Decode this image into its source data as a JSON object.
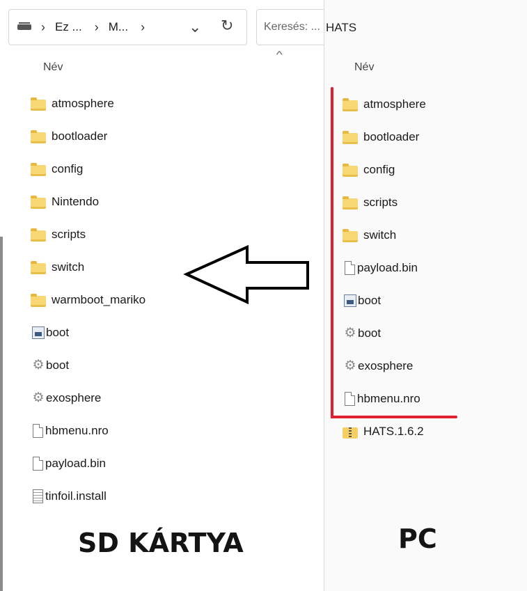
{
  "left_pane": {
    "breadcrumb": [
      "Ez ...",
      "M..."
    ],
    "column_header": "Név",
    "items": [
      {
        "icon": "folder-icon",
        "name": "atmosphere"
      },
      {
        "icon": "folder-icon",
        "name": "bootloader"
      },
      {
        "icon": "folder-icon",
        "name": "config"
      },
      {
        "icon": "folder-icon",
        "name": "Nintendo"
      },
      {
        "icon": "folder-icon",
        "name": "scripts"
      },
      {
        "icon": "folder-icon",
        "name": "switch"
      },
      {
        "icon": "folder-icon",
        "name": "warmboot_mariko"
      },
      {
        "icon": "batch-file-icon",
        "name": "boot"
      },
      {
        "icon": "settings-file-icon",
        "name": "boot"
      },
      {
        "icon": "settings-file-icon",
        "name": "exosphere"
      },
      {
        "icon": "file-icon",
        "name": "hbmenu.nro"
      },
      {
        "icon": "file-icon",
        "name": "payload.bin"
      },
      {
        "icon": "text-file-icon",
        "name": "tinfoil.install"
      }
    ],
    "annotation": "SD KÁRTYA"
  },
  "right_pane": {
    "search_label": "Keresés: ...",
    "search_term": "HATS",
    "column_header": "Név",
    "items": [
      {
        "icon": "folder-icon",
        "name": "atmosphere"
      },
      {
        "icon": "folder-icon",
        "name": "bootloader"
      },
      {
        "icon": "folder-icon",
        "name": "config"
      },
      {
        "icon": "folder-icon",
        "name": "scripts"
      },
      {
        "icon": "folder-icon",
        "name": "switch"
      },
      {
        "icon": "file-icon",
        "name": "payload.bin"
      },
      {
        "icon": "batch-file-icon",
        "name": "boot"
      },
      {
        "icon": "settings-file-icon",
        "name": "boot"
      },
      {
        "icon": "settings-file-icon",
        "name": "exosphere"
      },
      {
        "icon": "file-icon",
        "name": "hbmenu.nro"
      },
      {
        "icon": "zip-folder-icon",
        "name": "HATS.1.6.2"
      }
    ],
    "annotation": "PC"
  },
  "colors": {
    "marker_red": "#e0202e",
    "folder_yellow": "#f8d775"
  }
}
